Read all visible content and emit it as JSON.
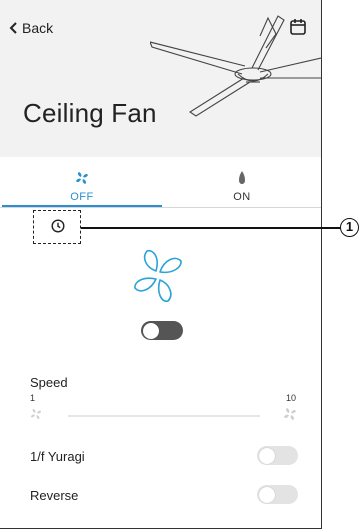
{
  "header": {
    "back_label": "Back",
    "title": "Ceiling Fan"
  },
  "tabs": [
    {
      "label": "OFF",
      "icon": "fan-icon",
      "active": true
    },
    {
      "label": "ON",
      "icon": "lamp-icon",
      "active": false
    }
  ],
  "power": {
    "on": false
  },
  "speed": {
    "label": "Speed",
    "min": "1",
    "max": "10"
  },
  "options": [
    {
      "label": "1/f Yuragi",
      "on": false
    },
    {
      "label": "Reverse",
      "on": false
    }
  ],
  "callout": {
    "number": "1"
  },
  "colors": {
    "accent": "#2a8fd0",
    "fan_blue": "#2ba3d6",
    "toggle_dark": "#555555",
    "toggle_light": "#e3e3e3"
  }
}
